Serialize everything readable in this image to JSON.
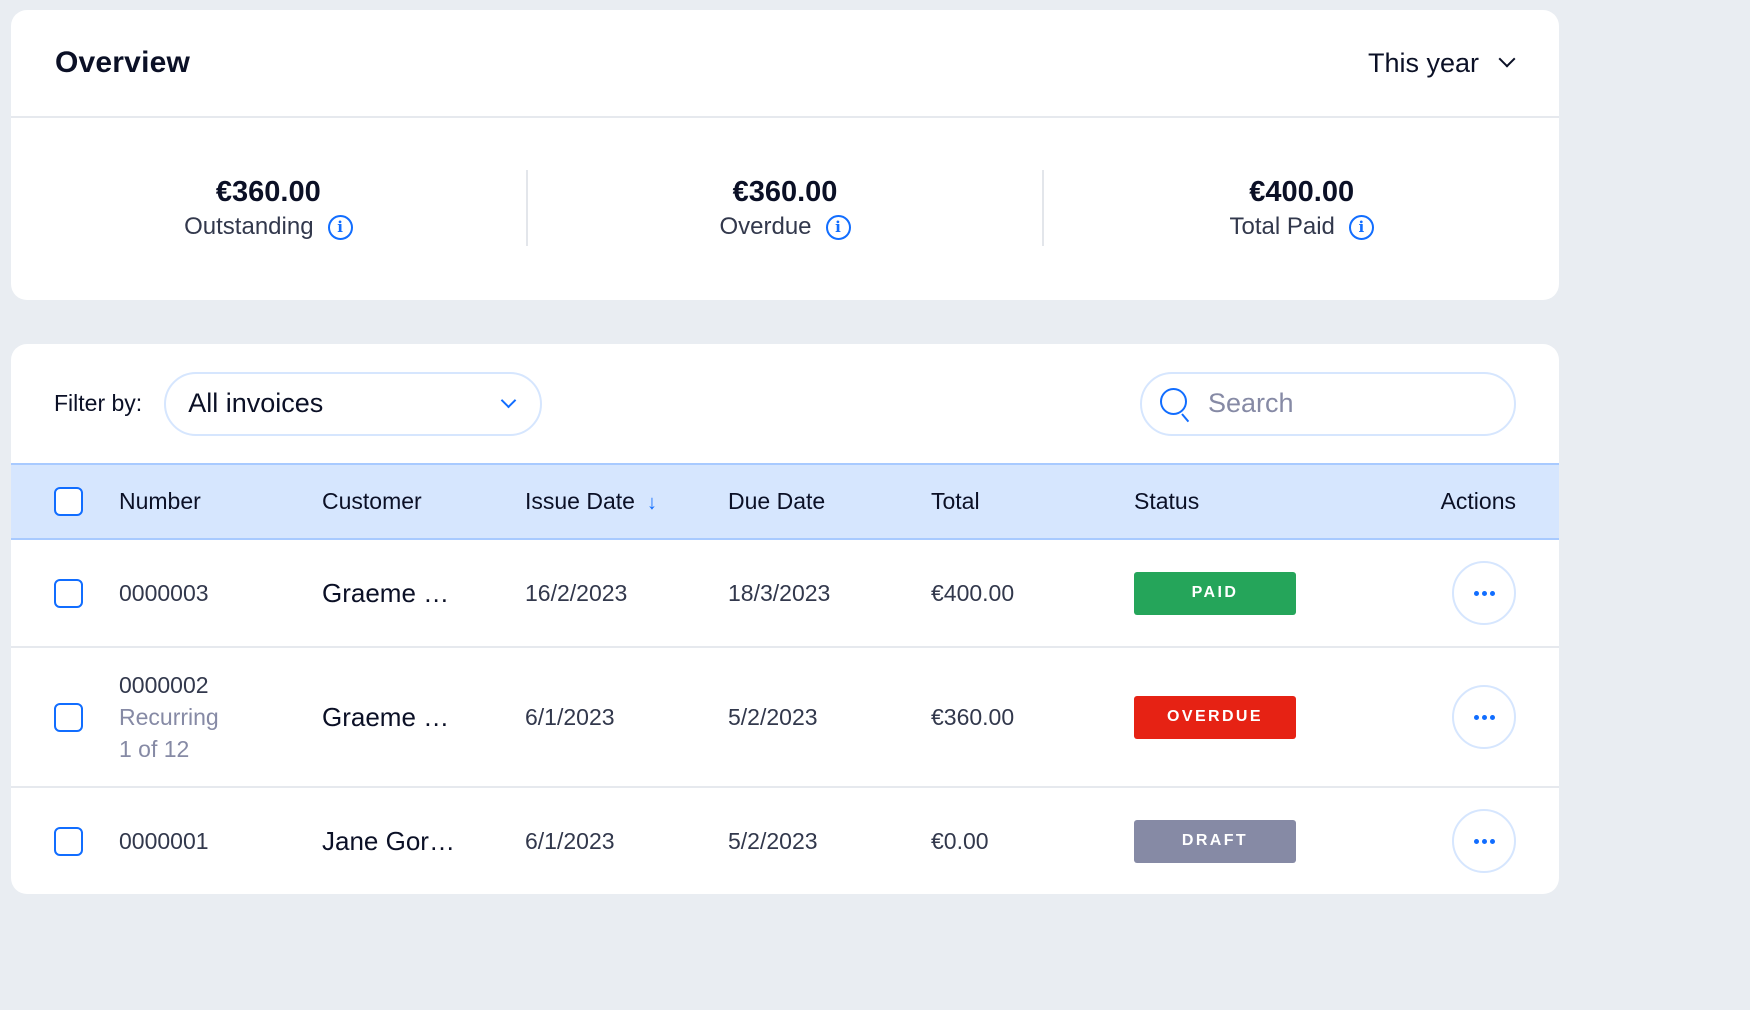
{
  "overview": {
    "title": "Overview",
    "period": {
      "selected": "This year"
    },
    "stats": [
      {
        "value": "€360.00",
        "label": "Outstanding",
        "icon": "info-icon"
      },
      {
        "value": "€360.00",
        "label": "Overdue",
        "icon": "info-icon"
      },
      {
        "value": "€400.00",
        "label": "Total Paid",
        "icon": "info-icon"
      }
    ]
  },
  "toolbar": {
    "filter_label": "Filter by:",
    "filter_selected": "All invoices",
    "search_placeholder": "Search",
    "search_value": ""
  },
  "table": {
    "columns": {
      "number": "Number",
      "customer": "Customer",
      "issue_date": "Issue Date",
      "due_date": "Due Date",
      "total": "Total",
      "status": "Status",
      "actions": "Actions"
    },
    "sort": {
      "column": "issue_date",
      "direction": "descending",
      "icon": "arrow-down-icon"
    },
    "rows": [
      {
        "number": "0000003",
        "recurring": null,
        "customer": "Graeme …",
        "issue_date": "16/2/2023",
        "due_date": "18/3/2023",
        "total": "€400.00",
        "status": "PAID",
        "checked": false
      },
      {
        "number": "0000002",
        "recurring": "Recurring",
        "recurring_progress": "1 of 12",
        "customer": "Graeme …",
        "issue_date": "6/1/2023",
        "due_date": "5/2/2023",
        "total": "€360.00",
        "status": "OVERDUE",
        "checked": false
      },
      {
        "number": "0000001",
        "recurring": null,
        "customer": "Jane Gor…",
        "issue_date": "6/1/2023",
        "due_date": "5/2/2023",
        "total": "€0.00",
        "status": "DRAFT",
        "checked": false
      }
    ]
  },
  "colors": {
    "accent": "#116dff",
    "status_paid": "#25a55a",
    "status_overdue": "#e62214",
    "status_draft": "#868aa5",
    "header_bg": "#d6e6fe",
    "page_bg": "#e9edf2"
  }
}
